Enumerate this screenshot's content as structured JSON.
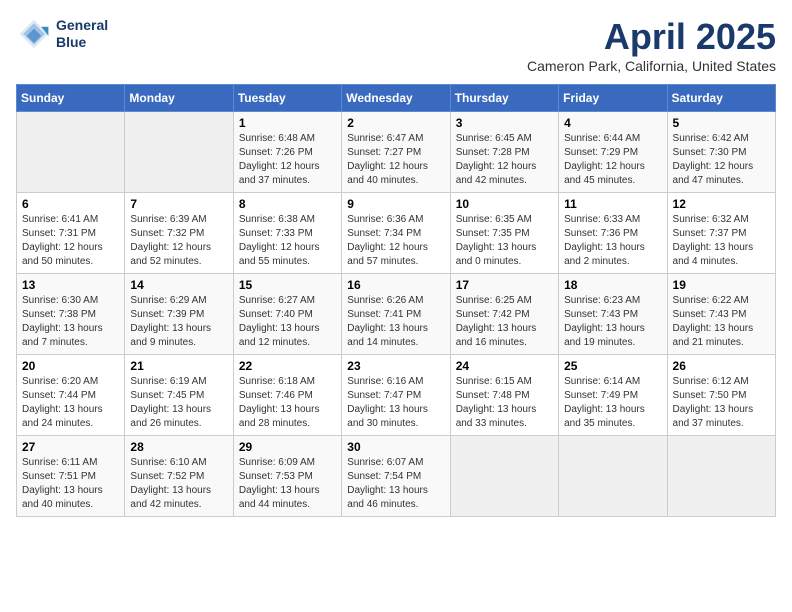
{
  "header": {
    "logo_line1": "General",
    "logo_line2": "Blue",
    "title": "April 2025",
    "subtitle": "Cameron Park, California, United States"
  },
  "calendar": {
    "headers": [
      "Sunday",
      "Monday",
      "Tuesday",
      "Wednesday",
      "Thursday",
      "Friday",
      "Saturday"
    ],
    "weeks": [
      [
        {
          "day": "",
          "sunrise": "",
          "sunset": "",
          "daylight": "",
          "empty": true
        },
        {
          "day": "",
          "sunrise": "",
          "sunset": "",
          "daylight": "",
          "empty": true
        },
        {
          "day": "1",
          "sunrise": "Sunrise: 6:48 AM",
          "sunset": "Sunset: 7:26 PM",
          "daylight": "Daylight: 12 hours and 37 minutes."
        },
        {
          "day": "2",
          "sunrise": "Sunrise: 6:47 AM",
          "sunset": "Sunset: 7:27 PM",
          "daylight": "Daylight: 12 hours and 40 minutes."
        },
        {
          "day": "3",
          "sunrise": "Sunrise: 6:45 AM",
          "sunset": "Sunset: 7:28 PM",
          "daylight": "Daylight: 12 hours and 42 minutes."
        },
        {
          "day": "4",
          "sunrise": "Sunrise: 6:44 AM",
          "sunset": "Sunset: 7:29 PM",
          "daylight": "Daylight: 12 hours and 45 minutes."
        },
        {
          "day": "5",
          "sunrise": "Sunrise: 6:42 AM",
          "sunset": "Sunset: 7:30 PM",
          "daylight": "Daylight: 12 hours and 47 minutes."
        }
      ],
      [
        {
          "day": "6",
          "sunrise": "Sunrise: 6:41 AM",
          "sunset": "Sunset: 7:31 PM",
          "daylight": "Daylight: 12 hours and 50 minutes."
        },
        {
          "day": "7",
          "sunrise": "Sunrise: 6:39 AM",
          "sunset": "Sunset: 7:32 PM",
          "daylight": "Daylight: 12 hours and 52 minutes."
        },
        {
          "day": "8",
          "sunrise": "Sunrise: 6:38 AM",
          "sunset": "Sunset: 7:33 PM",
          "daylight": "Daylight: 12 hours and 55 minutes."
        },
        {
          "day": "9",
          "sunrise": "Sunrise: 6:36 AM",
          "sunset": "Sunset: 7:34 PM",
          "daylight": "Daylight: 12 hours and 57 minutes."
        },
        {
          "day": "10",
          "sunrise": "Sunrise: 6:35 AM",
          "sunset": "Sunset: 7:35 PM",
          "daylight": "Daylight: 13 hours and 0 minutes."
        },
        {
          "day": "11",
          "sunrise": "Sunrise: 6:33 AM",
          "sunset": "Sunset: 7:36 PM",
          "daylight": "Daylight: 13 hours and 2 minutes."
        },
        {
          "day": "12",
          "sunrise": "Sunrise: 6:32 AM",
          "sunset": "Sunset: 7:37 PM",
          "daylight": "Daylight: 13 hours and 4 minutes."
        }
      ],
      [
        {
          "day": "13",
          "sunrise": "Sunrise: 6:30 AM",
          "sunset": "Sunset: 7:38 PM",
          "daylight": "Daylight: 13 hours and 7 minutes."
        },
        {
          "day": "14",
          "sunrise": "Sunrise: 6:29 AM",
          "sunset": "Sunset: 7:39 PM",
          "daylight": "Daylight: 13 hours and 9 minutes."
        },
        {
          "day": "15",
          "sunrise": "Sunrise: 6:27 AM",
          "sunset": "Sunset: 7:40 PM",
          "daylight": "Daylight: 13 hours and 12 minutes."
        },
        {
          "day": "16",
          "sunrise": "Sunrise: 6:26 AM",
          "sunset": "Sunset: 7:41 PM",
          "daylight": "Daylight: 13 hours and 14 minutes."
        },
        {
          "day": "17",
          "sunrise": "Sunrise: 6:25 AM",
          "sunset": "Sunset: 7:42 PM",
          "daylight": "Daylight: 13 hours and 16 minutes."
        },
        {
          "day": "18",
          "sunrise": "Sunrise: 6:23 AM",
          "sunset": "Sunset: 7:43 PM",
          "daylight": "Daylight: 13 hours and 19 minutes."
        },
        {
          "day": "19",
          "sunrise": "Sunrise: 6:22 AM",
          "sunset": "Sunset: 7:43 PM",
          "daylight": "Daylight: 13 hours and 21 minutes."
        }
      ],
      [
        {
          "day": "20",
          "sunrise": "Sunrise: 6:20 AM",
          "sunset": "Sunset: 7:44 PM",
          "daylight": "Daylight: 13 hours and 24 minutes."
        },
        {
          "day": "21",
          "sunrise": "Sunrise: 6:19 AM",
          "sunset": "Sunset: 7:45 PM",
          "daylight": "Daylight: 13 hours and 26 minutes."
        },
        {
          "day": "22",
          "sunrise": "Sunrise: 6:18 AM",
          "sunset": "Sunset: 7:46 PM",
          "daylight": "Daylight: 13 hours and 28 minutes."
        },
        {
          "day": "23",
          "sunrise": "Sunrise: 6:16 AM",
          "sunset": "Sunset: 7:47 PM",
          "daylight": "Daylight: 13 hours and 30 minutes."
        },
        {
          "day": "24",
          "sunrise": "Sunrise: 6:15 AM",
          "sunset": "Sunset: 7:48 PM",
          "daylight": "Daylight: 13 hours and 33 minutes."
        },
        {
          "day": "25",
          "sunrise": "Sunrise: 6:14 AM",
          "sunset": "Sunset: 7:49 PM",
          "daylight": "Daylight: 13 hours and 35 minutes."
        },
        {
          "day": "26",
          "sunrise": "Sunrise: 6:12 AM",
          "sunset": "Sunset: 7:50 PM",
          "daylight": "Daylight: 13 hours and 37 minutes."
        }
      ],
      [
        {
          "day": "27",
          "sunrise": "Sunrise: 6:11 AM",
          "sunset": "Sunset: 7:51 PM",
          "daylight": "Daylight: 13 hours and 40 minutes."
        },
        {
          "day": "28",
          "sunrise": "Sunrise: 6:10 AM",
          "sunset": "Sunset: 7:52 PM",
          "daylight": "Daylight: 13 hours and 42 minutes."
        },
        {
          "day": "29",
          "sunrise": "Sunrise: 6:09 AM",
          "sunset": "Sunset: 7:53 PM",
          "daylight": "Daylight: 13 hours and 44 minutes."
        },
        {
          "day": "30",
          "sunrise": "Sunrise: 6:07 AM",
          "sunset": "Sunset: 7:54 PM",
          "daylight": "Daylight: 13 hours and 46 minutes."
        },
        {
          "day": "",
          "sunrise": "",
          "sunset": "",
          "daylight": "",
          "empty": true
        },
        {
          "day": "",
          "sunrise": "",
          "sunset": "",
          "daylight": "",
          "empty": true
        },
        {
          "day": "",
          "sunrise": "",
          "sunset": "",
          "daylight": "",
          "empty": true
        }
      ]
    ]
  }
}
